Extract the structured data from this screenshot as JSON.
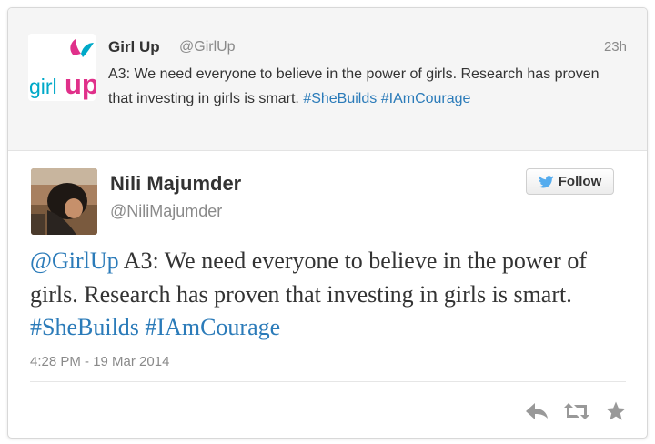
{
  "parent_tweet": {
    "author_name": "Girl Up",
    "author_handle": "@GirlUp",
    "time": "23h",
    "text": "A3: We need everyone to believe in the power of girls. Research has proven that investing in girls is smart.",
    "hashtags": [
      "#SheBuilds",
      "#IAmCourage"
    ],
    "avatar_logo_text": "girlup"
  },
  "tweet": {
    "author_name": "Nili Majumder",
    "author_handle": "@NiliMajumder",
    "follow_label": "Follow",
    "mention": "@GirlUp",
    "text": "A3: We need everyone to believe in the power of girls. Research has proven that investing in girls is smart.",
    "hashtags": [
      "#SheBuilds",
      "#IAmCourage"
    ],
    "timestamp": "4:28 PM - 19 Mar 2014"
  },
  "actions": {
    "icons": [
      "reply-icon",
      "retweet-icon",
      "favorite-icon"
    ]
  },
  "colors": {
    "link": "#2b7bb9",
    "twitter_blue": "#55acee",
    "brand_pink": "#e0308a",
    "text": "#333333",
    "muted": "#8a8a8a",
    "action_icons": "#999999"
  }
}
